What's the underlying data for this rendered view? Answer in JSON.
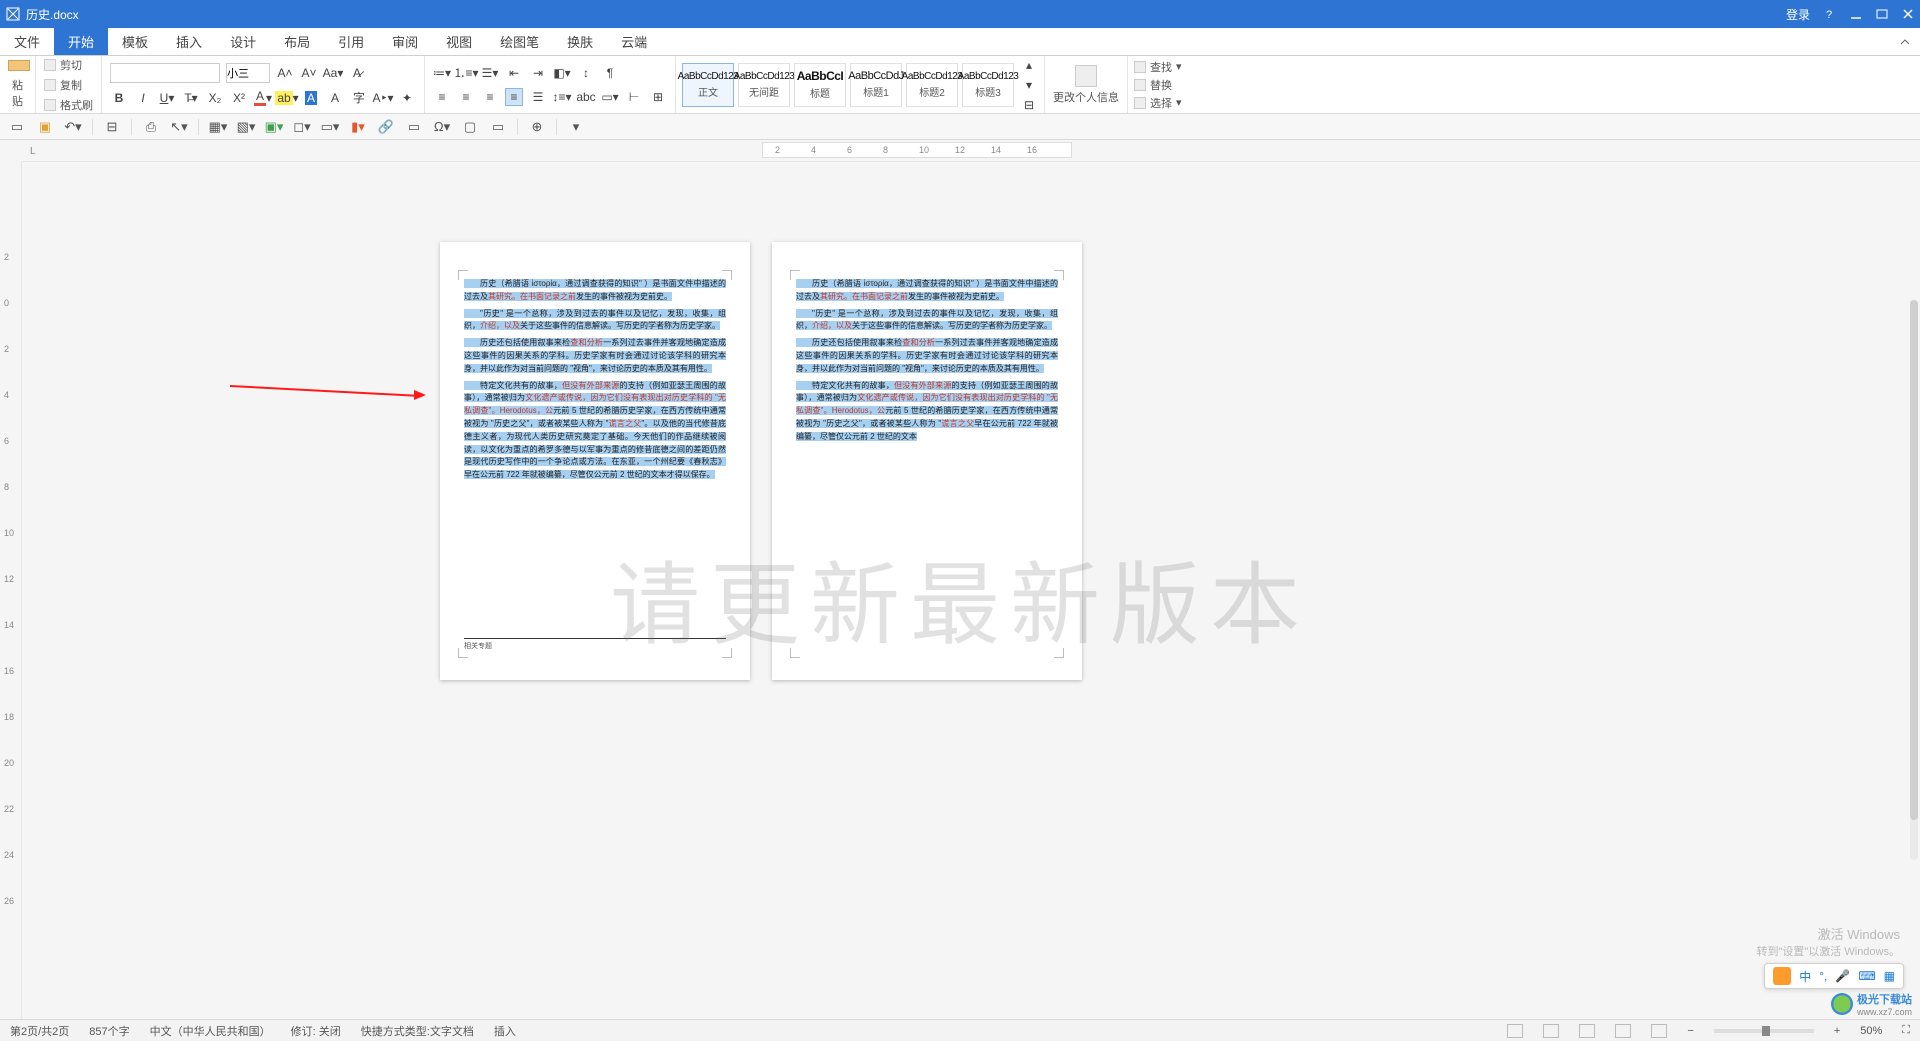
{
  "title": "历史.docx",
  "titlebar": {
    "login": "登录"
  },
  "menu": {
    "items": [
      "文件",
      "开始",
      "模板",
      "插入",
      "设计",
      "布局",
      "引用",
      "审阅",
      "视图",
      "绘图笔",
      "换肤",
      "云端"
    ],
    "active_index": 1
  },
  "clipboard": {
    "paste": "粘贴",
    "cut": "剪切",
    "copy": "复制",
    "format_painter": "格式刷"
  },
  "font": {
    "name": "",
    "size": "小三"
  },
  "styles": {
    "items": [
      {
        "preview": "AaBbCcDd123",
        "label": "正文"
      },
      {
        "preview": "AaBbCcDd123",
        "label": "无间距"
      },
      {
        "preview": "AaBbCcI",
        "label": "标题"
      },
      {
        "preview": "AaBbCcDdJ",
        "label": "标题1"
      },
      {
        "preview": "AaBbCcDd123",
        "label": "标题2"
      },
      {
        "preview": "AaBbCcDd123",
        "label": "标题3"
      }
    ],
    "selected_index": 0
  },
  "change_info": "更改个人信息",
  "editing": {
    "find": "查找",
    "replace": "替换",
    "select": "选择"
  },
  "hruler_ticks": [
    "2",
    "4",
    "6",
    "8",
    "10",
    "12",
    "14",
    "16"
  ],
  "vruler_ticks": [
    "2",
    "0",
    "2",
    "4",
    "6",
    "8",
    "10",
    "12",
    "14",
    "16",
    "18",
    "20",
    "22",
    "24",
    "26"
  ],
  "corner_mark": "L",
  "doc": {
    "p1": "历史（希腊语 ἱστορία，通过调查获得的知识\" ）是书面文件中描述的过去及",
    "p1r": "其研究。在书面记录之前",
    "p1b": "发生的事件被视为史前史。",
    "p2a": "\"历史\" 是一个总称，涉及到过去的事件以及记忆，发现，收集，组织，",
    "p2r": "介绍，以及",
    "p2b": "关于这些事件的信息解读。写历史的学者称为历史学家。",
    "p3a": "历史还包括使用叙事来检",
    "p3r": "查和分析",
    "p3b": "一系列过去事件并客观地确定造成这些事件的因果关系的学科。历史学家有时会通过讨论该学科的研究本身，并以此作为对当前问题的 \"视角\"，来讨论历史的本质及其有用性。",
    "p4a": "特定文化共有的故事，",
    "p4r1": "但没有外部来源",
    "p4b1": "的支持（例如亚瑟王周围的故事），通常被归为",
    "p4r2": "文化遗产或传说，因为它们没有表现出对历史学科的 \"无私调查\"。Herodotus，公",
    "p4b2": "元前 5 世纪的希腊历史学家，在西方传统中通常被视为 \"历史之父\"，或者被某些人称为 \"",
    "p4r3": "谎言之父",
    "p4b3": "\"。以及他的当代修昔底德主义者，为现代人类历史研究奠定了基础。今天他们的作品继续被阅读，以文化为重点的希罗多德与以军事为重点的修昔底德之间的差距仍然是现代历史写作中的一个争论点或方法。在东亚，一个州纪要《春秋志》早在公元前 722 年就被编纂，尽管仅公元前 2 世纪的文本才得以保存。",
    "p5b": "早在公元前 722 年就被编纂，尽管仅公元前 2 世纪的文本",
    "footnote": "相关专题"
  },
  "watermark": "请更新最新版本",
  "activation": {
    "t": "激活 Windows",
    "s": "转到\"设置\"以激活 Windows。"
  },
  "ime": {
    "lang": "中"
  },
  "brand": {
    "name": "极光下载站",
    "url": "www.xz7.com"
  },
  "status": {
    "pages": "第2页/共2页",
    "words": "857个字",
    "lang": "中文（中华人民共和国）",
    "track": "修订: 关闭",
    "shortcut": "快捷方式类型:文字文档",
    "mode": "插入",
    "zoom": "50%"
  }
}
